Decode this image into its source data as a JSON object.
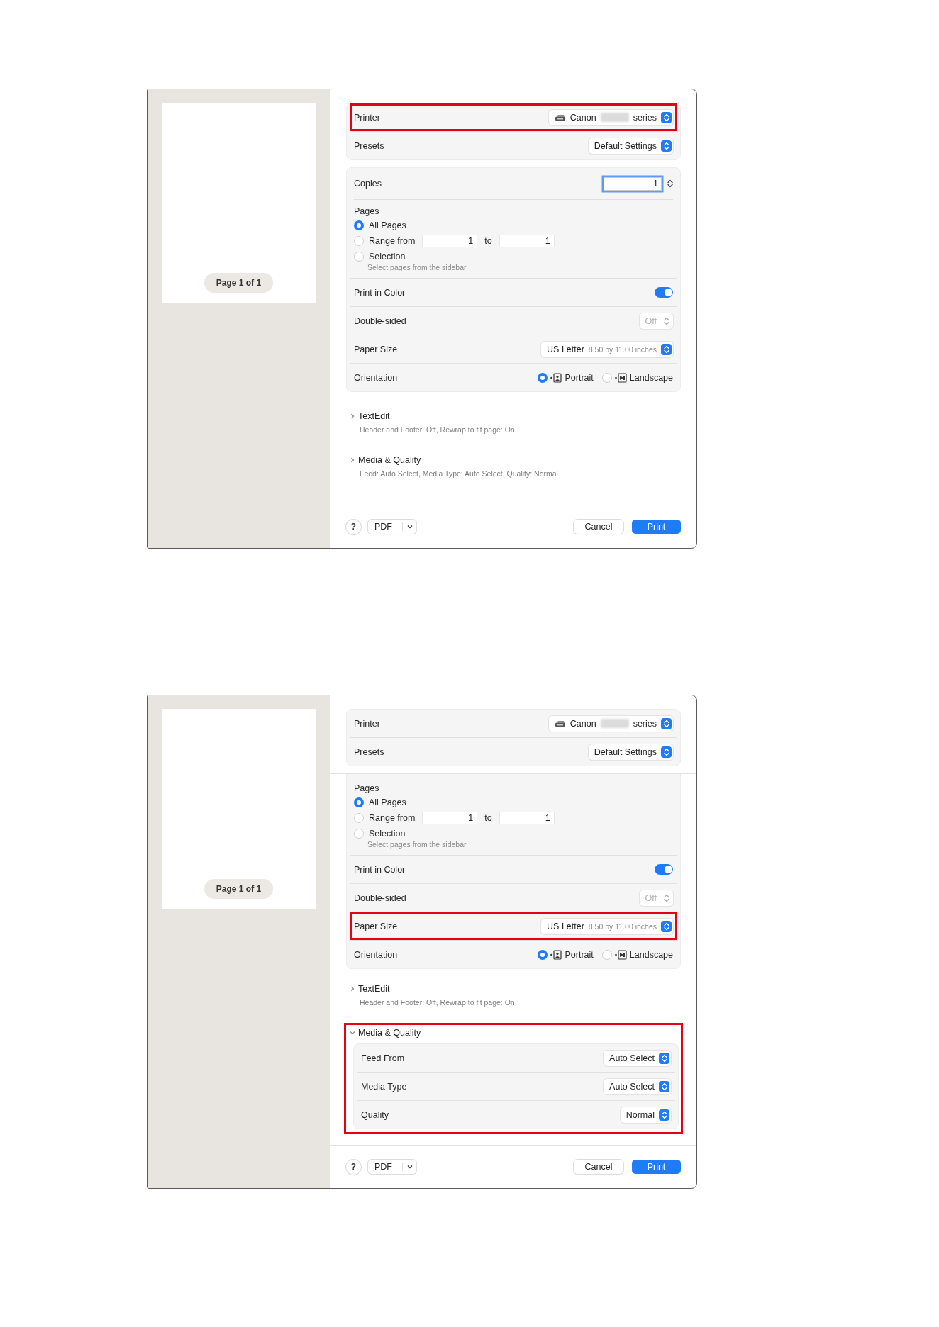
{
  "dialogs": [
    {
      "scrolled": false,
      "preview": {
        "page_label": "Page 1 of 1"
      },
      "top_rows": [
        {
          "kind": "printer",
          "label": "Printer",
          "value": "Canon",
          "suffix": "series",
          "redacted": true,
          "disabled": false,
          "highlighted": true
        },
        {
          "kind": "popup",
          "label": "Presets",
          "value": "Default Settings",
          "disabled": false,
          "highlighted": false
        }
      ],
      "main_rows": [
        {
          "kind": "stepper",
          "label": "Copies",
          "value": "1",
          "focused": true,
          "highlighted": false
        },
        {
          "kind": "pages",
          "label": "Pages",
          "highlighted": false,
          "options": [
            {
              "label": "All Pages",
              "selected": true
            },
            {
              "label": "Range from",
              "selected": false,
              "range": {
                "from": "1",
                "joiner": "to",
                "to": "1"
              }
            },
            {
              "label": "Selection",
              "selected": false,
              "note": "Select pages from the sidebar"
            }
          ]
        },
        {
          "kind": "toggle",
          "label": "Print in Color",
          "on": true,
          "highlighted": false
        },
        {
          "kind": "popup",
          "label": "Double-sided",
          "value": "Off",
          "disabled": true,
          "highlighted": false
        },
        {
          "kind": "popup",
          "label": "Paper Size",
          "value": "US Letter",
          "detail": "8.50 by 11.00 inches",
          "disabled": false,
          "highlighted": false
        },
        {
          "kind": "orientation",
          "label": "Orientation",
          "highlighted": false,
          "options": [
            {
              "label": "Portrait",
              "selected": true
            },
            {
              "label": "Landscape",
              "selected": false
            }
          ]
        }
      ],
      "sections": [
        {
          "title": "TextEdit",
          "expanded": false,
          "highlighted": false,
          "summary": "Header and Footer: Off, Rewrap to fit page: On"
        },
        {
          "title": "Media & Quality",
          "expanded": false,
          "highlighted": false,
          "summary": "Feed: Auto Select, Media Type: Auto Select, Quality: Normal"
        }
      ],
      "footer": {
        "help": "?",
        "pdf": "PDF",
        "cancel": "Cancel",
        "print": "Print"
      }
    },
    {
      "scrolled": true,
      "preview": {
        "page_label": "Page 1 of 1"
      },
      "top_rows": [
        {
          "kind": "printer",
          "label": "Printer",
          "value": "Canon",
          "suffix": "series",
          "redacted": true,
          "disabled": false,
          "highlighted": false
        },
        {
          "kind": "popup",
          "label": "Presets",
          "value": "Default Settings",
          "disabled": false,
          "highlighted": false
        }
      ],
      "main_rows": [
        {
          "kind": "pages",
          "label": "Pages",
          "highlighted": false,
          "options": [
            {
              "label": "All Pages",
              "selected": true
            },
            {
              "label": "Range from",
              "selected": false,
              "range": {
                "from": "1",
                "joiner": "to",
                "to": "1"
              }
            },
            {
              "label": "Selection",
              "selected": false,
              "note": "Select pages from the sidebar"
            }
          ]
        },
        {
          "kind": "toggle",
          "label": "Print in Color",
          "on": true,
          "highlighted": false
        },
        {
          "kind": "popup",
          "label": "Double-sided",
          "value": "Off",
          "disabled": true,
          "highlighted": false
        },
        {
          "kind": "popup",
          "label": "Paper Size",
          "value": "US Letter",
          "detail": "8.50 by 11.00 inches",
          "disabled": false,
          "highlighted": true
        },
        {
          "kind": "orientation",
          "label": "Orientation",
          "highlighted": false,
          "options": [
            {
              "label": "Portrait",
              "selected": true
            },
            {
              "label": "Landscape",
              "selected": false
            }
          ]
        }
      ],
      "sections": [
        {
          "title": "TextEdit",
          "expanded": false,
          "highlighted": false,
          "summary": "Header and Footer: Off, Rewrap to fit page: On"
        },
        {
          "title": "Media & Quality",
          "expanded": true,
          "highlighted": true,
          "rows": [
            {
              "kind": "popup",
              "label": "Feed From",
              "value": "Auto Select",
              "disabled": false,
              "highlighted": false
            },
            {
              "kind": "popup",
              "label": "Media Type",
              "value": "Auto Select",
              "disabled": false,
              "highlighted": false
            },
            {
              "kind": "popup",
              "label": "Quality",
              "value": "Normal",
              "disabled": false,
              "highlighted": false
            }
          ]
        }
      ],
      "footer": {
        "help": "?",
        "pdf": "PDF",
        "cancel": "Cancel",
        "print": "Print"
      }
    }
  ]
}
